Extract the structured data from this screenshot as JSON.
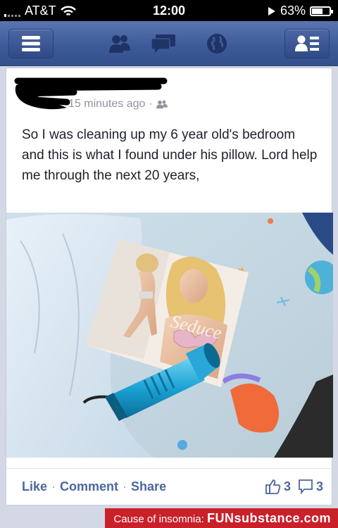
{
  "status_bar": {
    "carrier": "AT&T",
    "time": "12:00",
    "battery": "63%",
    "battery_level": 0.63
  },
  "navbar": {
    "menu_icon": "menu-icon",
    "friends_icon": "friend-requests-icon",
    "messages_icon": "messages-icon",
    "notifications_icon": "globe-icon",
    "contacts_icon": "contacts-icon"
  },
  "post": {
    "timestamp": "15 minutes ago",
    "separator": "·",
    "privacy_icon": "friends-icon",
    "text": "So I was cleaning up my 6 year old's bedroom and this is what I found under his pillow.  Lord help me through the next 20 years,",
    "photo_brand_text": "Seduce"
  },
  "actions": {
    "like": "Like",
    "comment": "Comment",
    "share": "Share",
    "dot": "·",
    "like_count": "3",
    "comment_count": "3"
  },
  "watermark": {
    "prefix": "Cause of insomnia:",
    "brand": "FUNsubstance.com"
  }
}
